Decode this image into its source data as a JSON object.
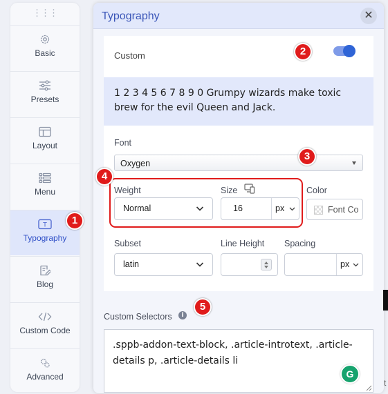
{
  "sidebar": {
    "items": [
      {
        "label": "Basic",
        "icon": "gear-icon",
        "active": false
      },
      {
        "label": "Presets",
        "icon": "sliders-icon",
        "active": false
      },
      {
        "label": "Layout",
        "icon": "layout-icon",
        "active": false
      },
      {
        "label": "Menu",
        "icon": "menu-list-icon",
        "active": false
      },
      {
        "label": "Typography",
        "icon": "typography-icon",
        "active": true
      },
      {
        "label": "Blog",
        "icon": "blog-icon",
        "active": false
      },
      {
        "label": "Custom Code",
        "icon": "code-icon",
        "active": false
      },
      {
        "label": "Advanced",
        "icon": "advanced-gears-icon",
        "active": false
      }
    ]
  },
  "panel": {
    "title": "Typography",
    "close_symbol": "✕",
    "custom_label": "Custom",
    "custom_enabled": true,
    "preview_text": "1 2 3 4 5 6 7 8 9 0 Grumpy wizards make toxic brew for the evil Queen and Jack.",
    "font": {
      "label": "Font",
      "value": "Oxygen"
    },
    "weight": {
      "label": "Weight",
      "value": "Normal"
    },
    "size": {
      "label": "Size",
      "value": "16",
      "unit": "px"
    },
    "color": {
      "label": "Color",
      "placeholder": "Font Co"
    },
    "subset": {
      "label": "Subset",
      "value": "latin"
    },
    "line_height": {
      "label": "Line Height",
      "value": ""
    },
    "spacing": {
      "label": "Spacing",
      "value": "",
      "unit": "px"
    },
    "custom_selectors": {
      "label": "Custom Selectors",
      "info_symbol": "i",
      "value": ".sppb-addon-text-block, .article-introtext, .article-details p, .article-details li"
    }
  },
  "callouts": [
    "1",
    "2",
    "3",
    "4",
    "5"
  ],
  "grammarly_letter": "G",
  "edge_text": "t",
  "colors": {
    "accent": "#2f64d6",
    "active_bg": "#dfe6fb",
    "callout_red": "#e01b1b",
    "grammarly_green": "#17a36e"
  }
}
